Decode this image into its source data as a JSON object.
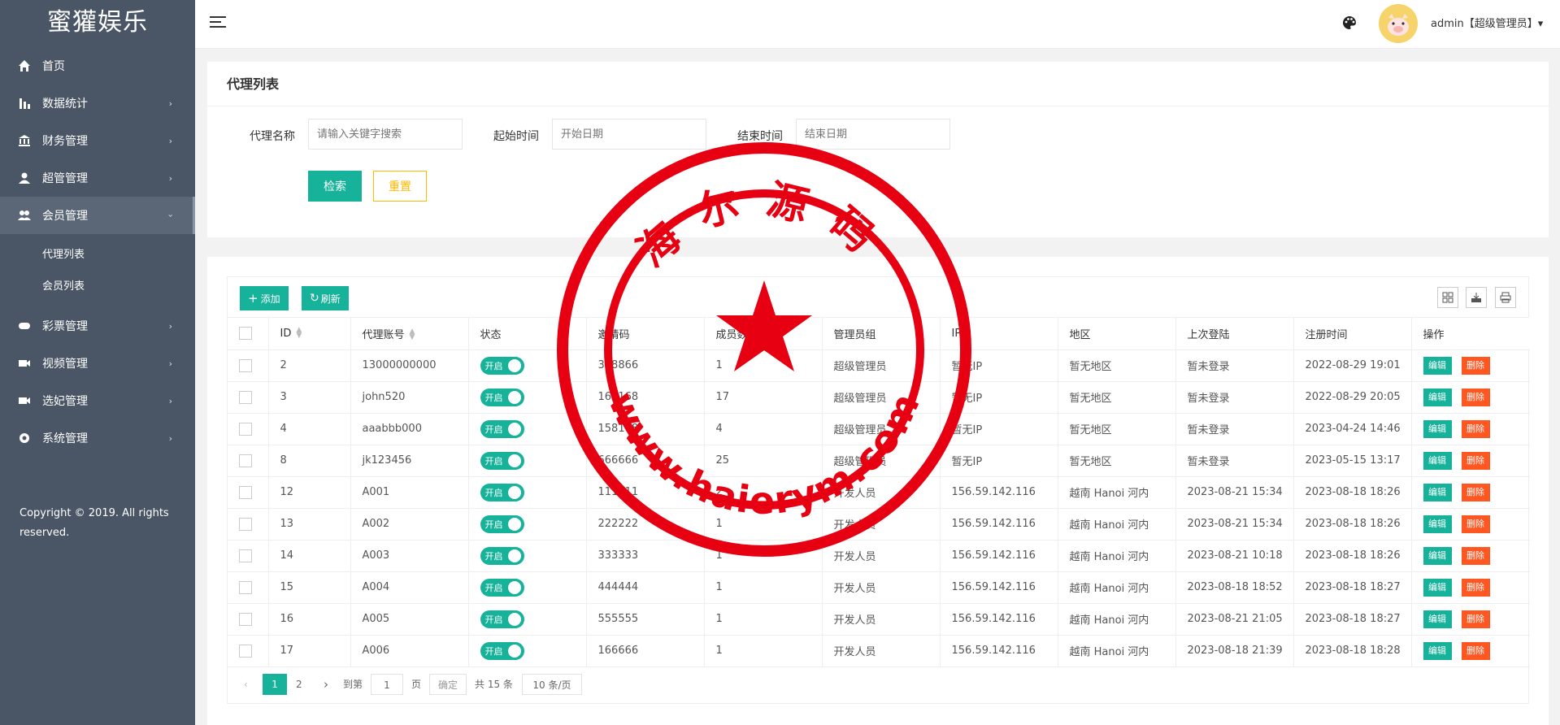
{
  "brand": "蜜獾娱乐",
  "sidebar": {
    "items": [
      {
        "label": "首页",
        "icon": "home-icon",
        "arrow": ""
      },
      {
        "label": "数据统计",
        "icon": "chart-icon",
        "arrow": "›"
      },
      {
        "label": "财务管理",
        "icon": "bank-icon",
        "arrow": "›"
      },
      {
        "label": "超管管理",
        "icon": "user-icon",
        "arrow": "›"
      },
      {
        "label": "会员管理",
        "icon": "users-icon",
        "arrow": "›"
      },
      {
        "label": "彩票管理",
        "icon": "gamepad-icon",
        "arrow": "›"
      },
      {
        "label": "视频管理",
        "icon": "video-icon",
        "arrow": "›"
      },
      {
        "label": "选妃管理",
        "icon": "camera-icon",
        "arrow": "›"
      },
      {
        "label": "系统管理",
        "icon": "gear-icon",
        "arrow": "›"
      }
    ],
    "submenu": [
      "代理列表",
      "会员列表"
    ],
    "copyright": "Copyright © 2019. All rights reserved."
  },
  "topbar": {
    "user": "admin【超级管理员】▾"
  },
  "search": {
    "title": "代理列表",
    "name_label": "代理名称",
    "name_placeholder": "请输入关键字搜索",
    "start_label": "起始时间",
    "start_placeholder": "开始日期",
    "end_label": "结束时间",
    "end_placeholder": "结束日期",
    "search_btn": "检索",
    "reset_btn": "重置"
  },
  "toolbar": {
    "add": "添加",
    "refresh": "刷新"
  },
  "table": {
    "headers": [
      "ID",
      "代理账号",
      "状态",
      "邀请码",
      "成员数",
      "管理员组",
      "IP",
      "地区",
      "上次登陆",
      "注册时间",
      "操作"
    ],
    "switch_label": "开启",
    "edit_label": "编辑",
    "delete_label": "删除",
    "rows": [
      {
        "id": "2",
        "account": "13000000000",
        "code": "338866",
        "members": "1",
        "group": "超级管理员",
        "ip": "暂无IP",
        "region": "暂无地区",
        "last": "暂未登录",
        "reg": "2022-08-29 19:01"
      },
      {
        "id": "3",
        "account": "john520",
        "code": "168168",
        "members": "17",
        "group": "超级管理员",
        "ip": "暂无IP",
        "region": "暂无地区",
        "last": "暂未登录",
        "reg": "2022-08-29 20:05"
      },
      {
        "id": "4",
        "account": "aaabbb000",
        "code": "158168",
        "members": "4",
        "group": "超级管理员",
        "ip": "暂无IP",
        "region": "暂无地区",
        "last": "暂未登录",
        "reg": "2023-04-24 14:46"
      },
      {
        "id": "8",
        "account": "jk123456",
        "code": "666666",
        "members": "25",
        "group": "超级管理员",
        "ip": "暂无IP",
        "region": "暂无地区",
        "last": "暂未登录",
        "reg": "2023-05-15 13:17"
      },
      {
        "id": "12",
        "account": "A001",
        "code": "111111",
        "members": "2",
        "group": "开发人员",
        "ip": "156.59.142.116",
        "region": "越南 Hanoi 河内",
        "last": "2023-08-21 15:34",
        "reg": "2023-08-18 18:26"
      },
      {
        "id": "13",
        "account": "A002",
        "code": "222222",
        "members": "1",
        "group": "开发人员",
        "ip": "156.59.142.116",
        "region": "越南 Hanoi 河内",
        "last": "2023-08-21 15:34",
        "reg": "2023-08-18 18:26"
      },
      {
        "id": "14",
        "account": "A003",
        "code": "333333",
        "members": "1",
        "group": "开发人员",
        "ip": "156.59.142.116",
        "region": "越南 Hanoi 河内",
        "last": "2023-08-21 10:18",
        "reg": "2023-08-18 18:26"
      },
      {
        "id": "15",
        "account": "A004",
        "code": "444444",
        "members": "1",
        "group": "开发人员",
        "ip": "156.59.142.116",
        "region": "越南 Hanoi 河内",
        "last": "2023-08-18 18:52",
        "reg": "2023-08-18 18:27"
      },
      {
        "id": "16",
        "account": "A005",
        "code": "555555",
        "members": "1",
        "group": "开发人员",
        "ip": "156.59.142.116",
        "region": "越南 Hanoi 河内",
        "last": "2023-08-21 21:05",
        "reg": "2023-08-18 18:27"
      },
      {
        "id": "17",
        "account": "A006",
        "code": "166666",
        "members": "1",
        "group": "开发人员",
        "ip": "156.59.142.116",
        "region": "越南 Hanoi 河内",
        "last": "2023-08-18 21:39",
        "reg": "2023-08-18 18:28"
      }
    ]
  },
  "pager": {
    "prev": "‹",
    "pages": [
      "1",
      "2"
    ],
    "next": "›",
    "goto_label": "到第",
    "goto_value": "1",
    "page_unit": "页",
    "confirm": "确定",
    "total": "共 15 条",
    "per_page": "10 条/页"
  },
  "watermark": {
    "top_text": "海尔源码",
    "bottom_text": "www.haierym.com",
    "color": "#e60012"
  },
  "colors": {
    "accent": "#16b29a",
    "danger": "#ff5722",
    "warning": "#ffb800",
    "sidebar": "#4a5565"
  }
}
